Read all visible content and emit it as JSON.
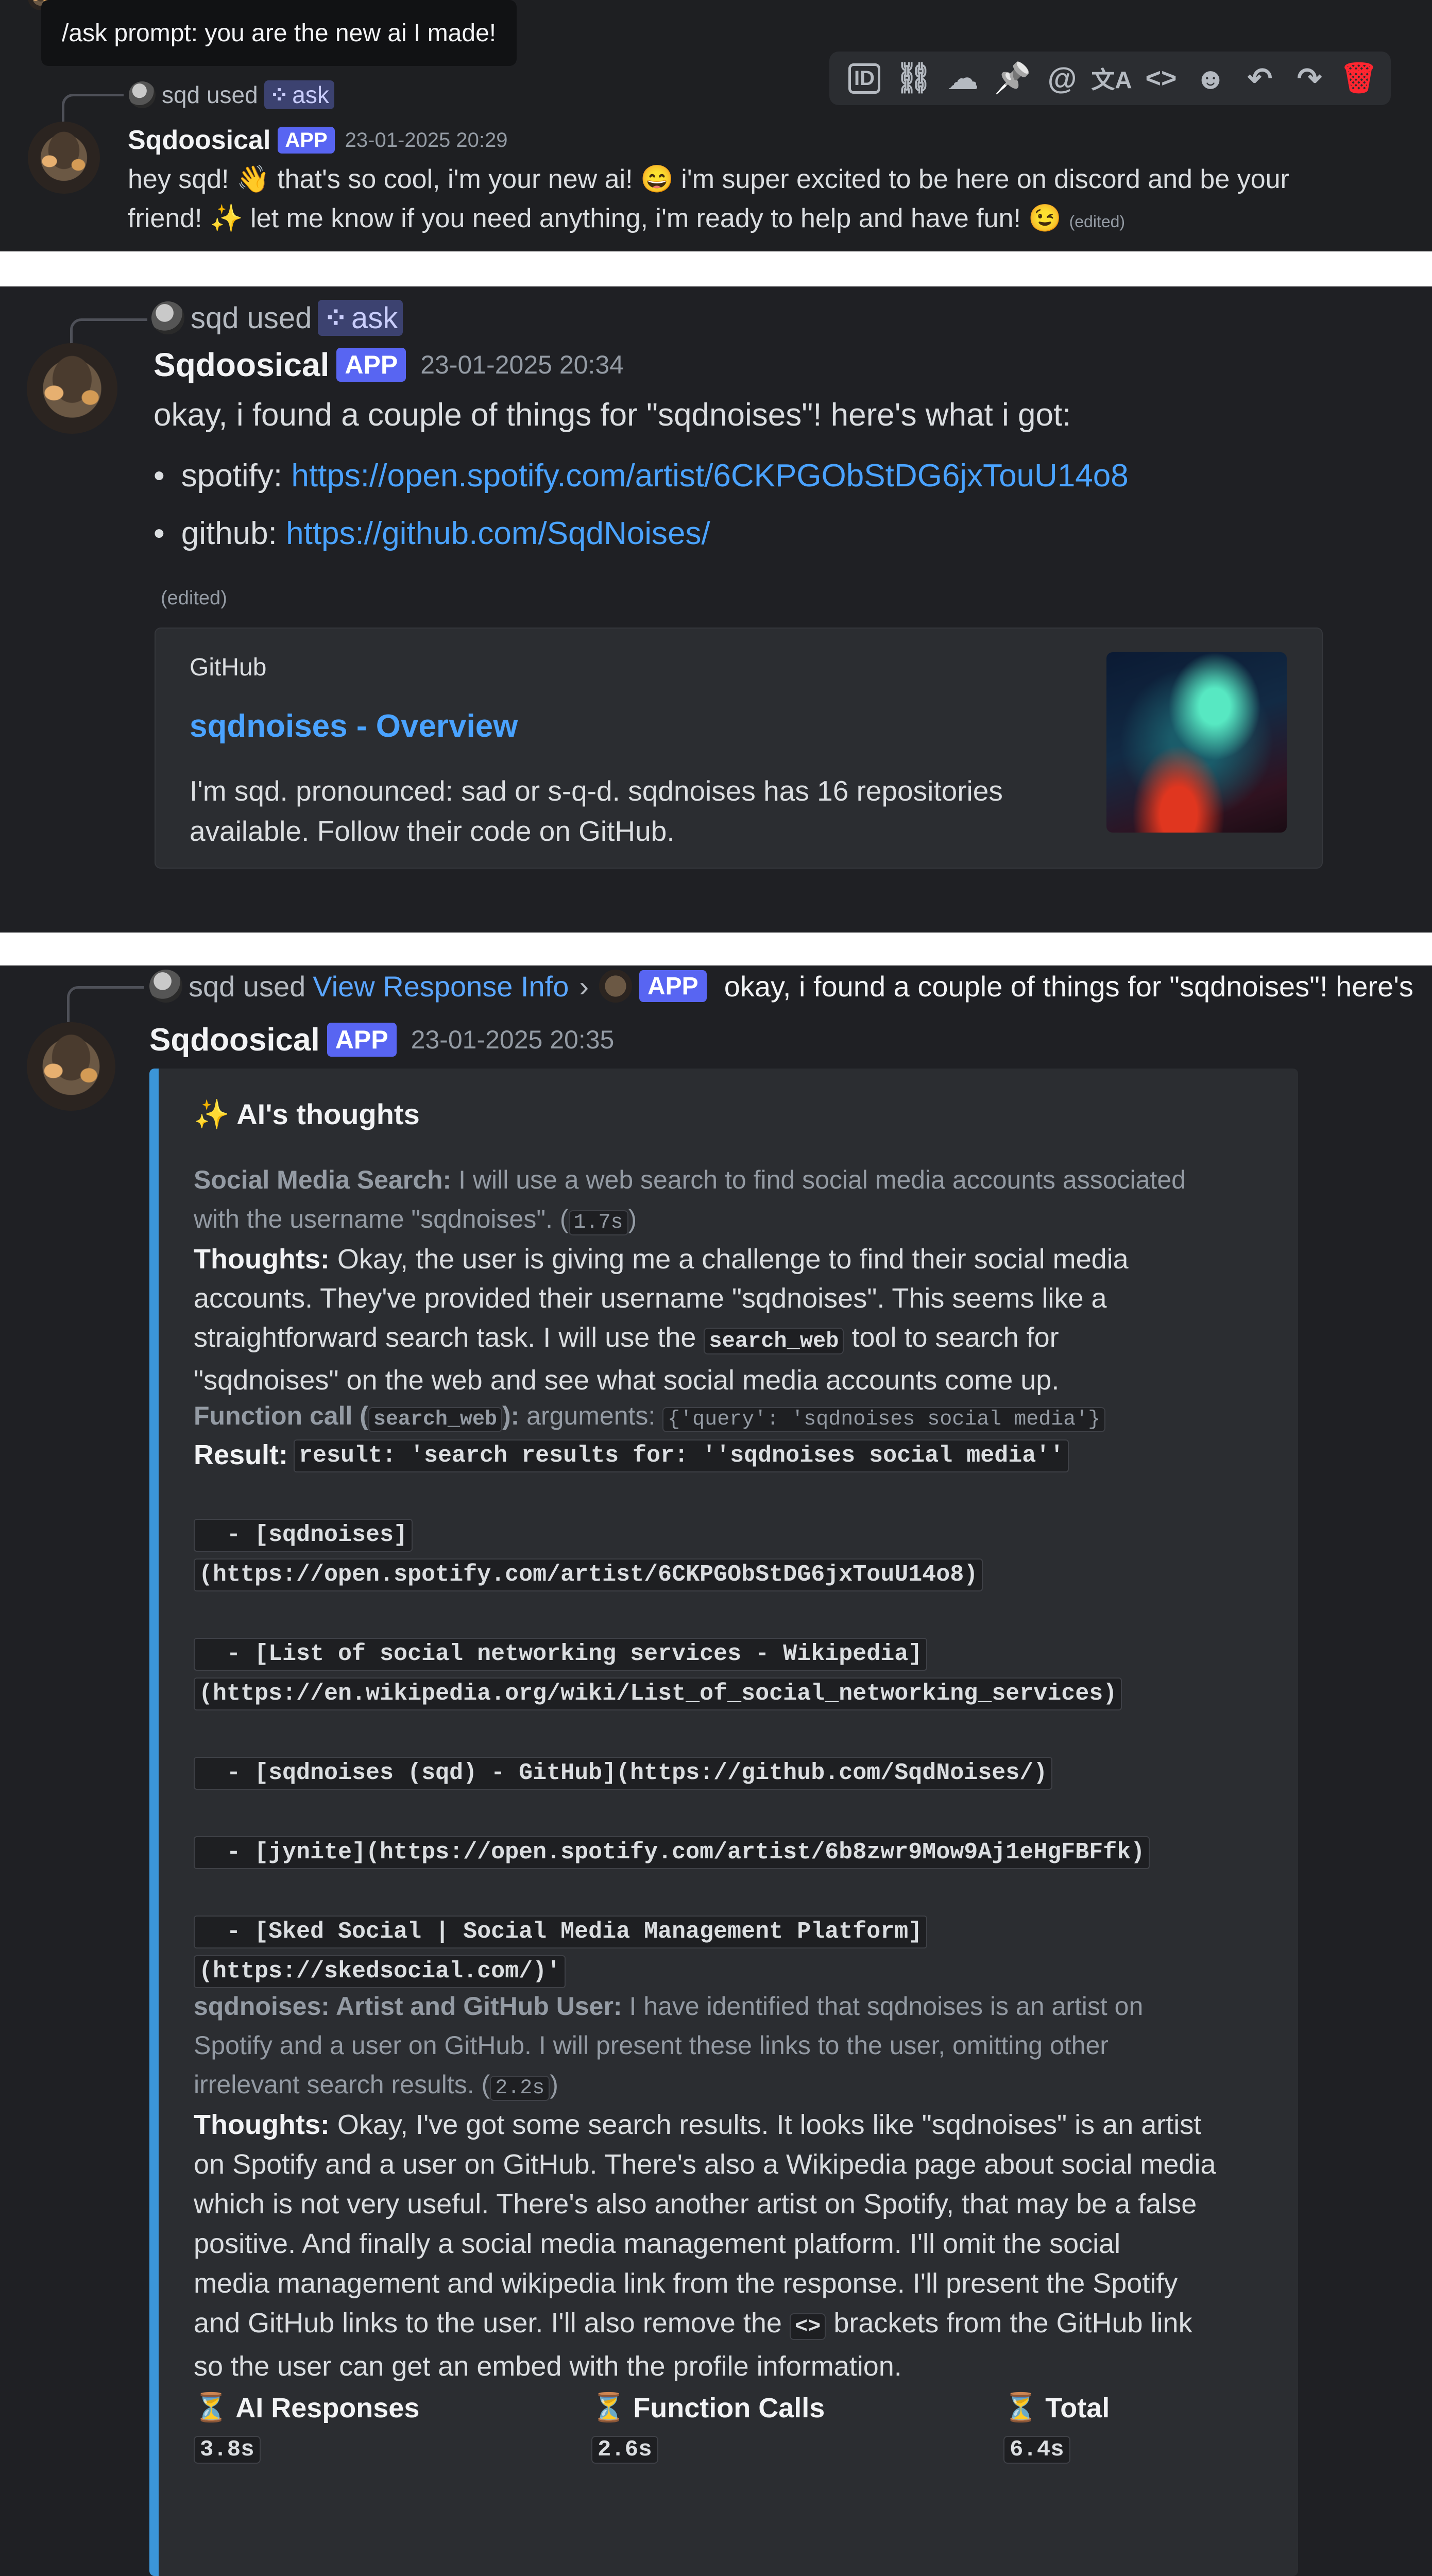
{
  "tooltip": {
    "text": "/ask prompt: you are the new ai I made!"
  },
  "toolbar": {
    "icons": [
      "id-icon",
      "link-icon",
      "thread-icon",
      "pin-icon",
      "mention-icon",
      "translate-icon",
      "code-icon",
      "emoji-icon",
      "reply-icon",
      "forward-icon",
      "trash-icon"
    ],
    "glyphs": [
      "ID",
      "⛓",
      "☁",
      "📌",
      "@",
      "文A",
      "<>",
      "☻",
      "↶",
      "↷",
      "🗑"
    ],
    "delete_color": "#e5484d"
  },
  "message1": {
    "reply_user": "sqd used",
    "reply_command": "ask",
    "author": "Sqdoosical",
    "badge": "APP",
    "timestamp": "23-01-2025 20:29",
    "line1_a": "hey sqd! ",
    "line1_emoji": "👋",
    "line1_b": " that's so cool, i'm your new ai! ",
    "line1_emoji2": "😄",
    "line1_c": " i'm super excited to be here on discord and be your",
    "line2_a": "friend! ",
    "line2_emoji": "✨",
    "line2_b": " let me know if you need anything, i'm ready to help and have fun! ",
    "line2_emoji2": "😉",
    "edited": "(edited)"
  },
  "message2": {
    "reply_user": "sqd used",
    "reply_command": "ask",
    "author": "Sqdoosical",
    "badge": "APP",
    "timestamp": "23-01-2025 20:34",
    "text": "okay, i found a couple of things for \"sqdnoises\"! here's what i got:",
    "bullets": [
      {
        "label": "spotify: ",
        "url": "https://open.spotify.com/artist/6CKPGObStDG6jxTouU14o8"
      },
      {
        "label": "github: ",
        "url": "https://github.com/SqdNoises/"
      }
    ],
    "edited": "(edited)",
    "embed": {
      "provider": "GitHub",
      "title": "sqdnoises - Overview",
      "description_line1": "I'm sqd. pronounced: sad or s-q-d. sqdnoises has 16 repositories",
      "description_line2": "available. Follow their code on GitHub."
    }
  },
  "message3": {
    "reply_user": "sqd used",
    "reply_link": "View Response Info",
    "reply_sep": "›",
    "reply_badge": "APP",
    "reply_preview": "okay, i found a couple of things for \"sqdnoises\"! here's",
    "author": "Sqdoosical",
    "badge": "APP",
    "timestamp": "23-01-2025 20:35",
    "thoughts": {
      "title": "AI's thoughts",
      "step1_label": "Social Media Search:",
      "step1_text": " I will use a web search to find social media accounts associated",
      "step1_text2": "with the username \"sqdnoises\". (",
      "step1_time": "1.7s",
      "step1_close": ")",
      "thoughts1_label": "Thoughts:",
      "thoughts1_l1": " Okay, the user is giving me a challenge to find their social media",
      "thoughts1_l2": "accounts. They've provided their username \"sqdnoises\". This seems like a",
      "thoughts1_l3a": "straightforward search task. I will use the ",
      "thoughts1_l3code": "search_web",
      "thoughts1_l3b": " tool to search for",
      "thoughts1_l4": "\"sqdnoises\" on the web and see what social media accounts come up.",
      "fc_label": "Function call (",
      "fc_code": "search_web",
      "fc_close": "):",
      "fc_args_label": " arguments: ",
      "fc_args": "{'query': 'sqdnoises social media'}",
      "result_label": "Result:",
      "result_lines": [
        "result: 'search results for: ''sqdnoises social media''",
        "",
        "  - [sqdnoises]",
        "(https://open.spotify.com/artist/6CKPGObStDG6jxTouU14o8)",
        "",
        "  - [List of social networking services - Wikipedia]",
        "(https://en.wikipedia.org/wiki/List_of_social_networking_services)",
        "",
        "  - [sqdnoises (sqd) - GitHub](https://github.com/SqdNoises/)",
        "",
        "  - [jynite](https://open.spotify.com/artist/6b8zwr9Mow9Aj1eHgFBFfk)",
        "",
        "  - [Sked Social | Social Media Management Platform]",
        "(https://skedsocial.com/)'"
      ],
      "step2_label": "sqdnoises: Artist and GitHub User:",
      "step2_text": " I have identified that sqdnoises is an artist on",
      "step2_text2": "Spotify and a user on GitHub. I will present these links to the user, omitting other",
      "step2_text3": "irrelevant search results. (",
      "step2_time": "2.2s",
      "step2_close": ")",
      "thoughts2_label": "Thoughts:",
      "thoughts2_l1": " Okay, I've got some search results. It looks like \"sqdnoises\" is an artist",
      "thoughts2_l2": "on Spotify and a user on GitHub. There's also a Wikipedia page about social media",
      "thoughts2_l3": "which is not very useful. There's also another artist on Spotify, that may be a false",
      "thoughts2_l4": "positive. And finally a social media management platform. I'll omit the social",
      "thoughts2_l5": "media management and wikipedia link from the response. I'll present the Spotify",
      "thoughts2_l6a": "and GitHub links to the user. I'll also remove the ",
      "thoughts2_l6code": "<>",
      "thoughts2_l6b": " brackets from the GitHub link",
      "thoughts2_l7": "so the user can get an embed with the profile information.",
      "stats": [
        {
          "label": "AI Responses",
          "value": "3.8s"
        },
        {
          "label": "Function Calls",
          "value": "2.6s"
        },
        {
          "label": "Total",
          "value": "6.4s"
        }
      ]
    }
  }
}
